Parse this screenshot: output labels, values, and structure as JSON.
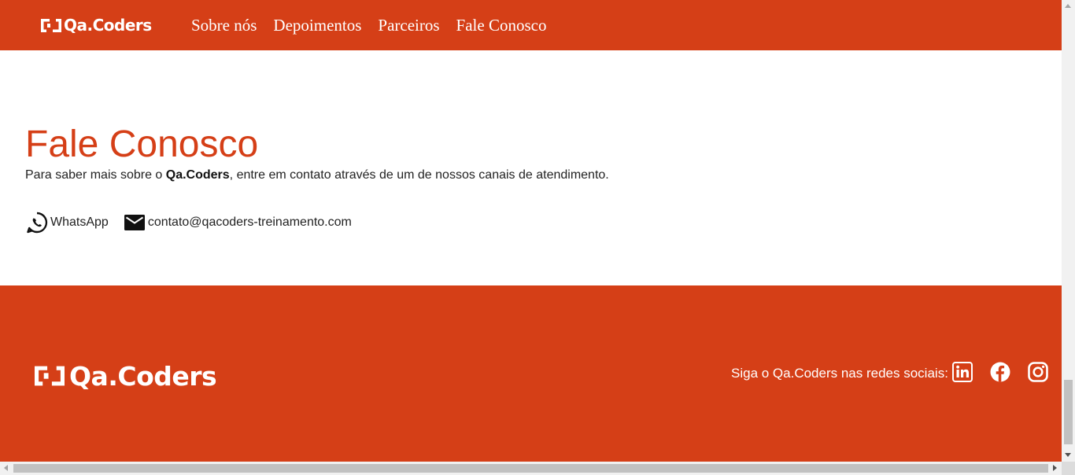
{
  "header": {
    "logo_text": "Qa.Coders",
    "nav": [
      "Sobre nós",
      "Depoimentos",
      "Parceiros",
      "Fale Conosco"
    ]
  },
  "contact": {
    "title": "Fale Conosco",
    "desc_prefix": "Para saber mais sobre o ",
    "desc_brand": "Qa.Coders",
    "desc_suffix": ", entre em contato através de um de nossos canais de atendimento.",
    "whatsapp_label": "WhatsApp",
    "email": "contato@qacoders-treinamento.com"
  },
  "footer": {
    "logo_text": "Qa.Coders",
    "social_text": "Siga o Qa.Coders nas redes sociais:",
    "social_icons": [
      "linkedin-icon",
      "facebook-icon",
      "instagram-icon"
    ]
  },
  "colors": {
    "brand": "#d53f17",
    "text": "#222222",
    "white": "#ffffff"
  }
}
